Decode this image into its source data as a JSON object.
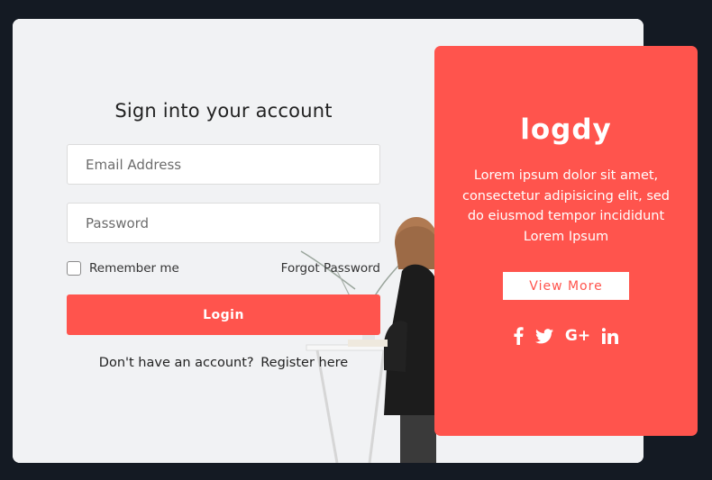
{
  "form": {
    "title": "Sign into your account",
    "email_placeholder": "Email Address",
    "email_value": "",
    "password_placeholder": "Password",
    "password_value": "",
    "remember_label": "Remember me",
    "remember_checked": false,
    "forgot_label": "Forgot Password",
    "login_label": "Login",
    "register_prompt": "Don't have an account?",
    "register_link": "Register here"
  },
  "panel": {
    "logo": "logdy",
    "description": "Lorem ipsum dolor sit amet, consectetur adipisicing elit, sed do eiusmod tempor incididunt Lorem Ipsum",
    "view_more_label": "View More",
    "social": [
      {
        "icon": "facebook-icon",
        "glyph": "f"
      },
      {
        "icon": "twitter-icon",
        "glyph": ""
      },
      {
        "icon": "google-plus-icon",
        "glyph": "G+"
      },
      {
        "icon": "linkedin-icon",
        "glyph": "in"
      }
    ]
  },
  "colors": {
    "background": "#141a23",
    "accent": "#ff544d",
    "card": "#f0f1f3"
  }
}
